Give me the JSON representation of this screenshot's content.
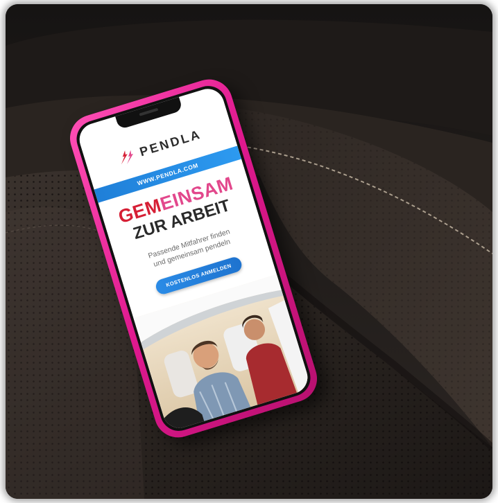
{
  "scene": {
    "phone_case_color": "#e0198f",
    "seat_color": "#2a2420",
    "stitch_color": "#c9bca8"
  },
  "app": {
    "brand": "PENDLA",
    "url": "WWW.PENDLA.COM",
    "headline_red": "GEM",
    "headline_pink": "EINSAM",
    "headline_line2": "ZUR ARBEIT",
    "subtitle_line1": "Passende Mitfahrer finden",
    "subtitle_line2": "und gemeinsam pendeln",
    "cta_label": "KOSTENLOS ANMELDEN",
    "accent": "#1f7fd8",
    "brand_red": "#d61f35"
  }
}
